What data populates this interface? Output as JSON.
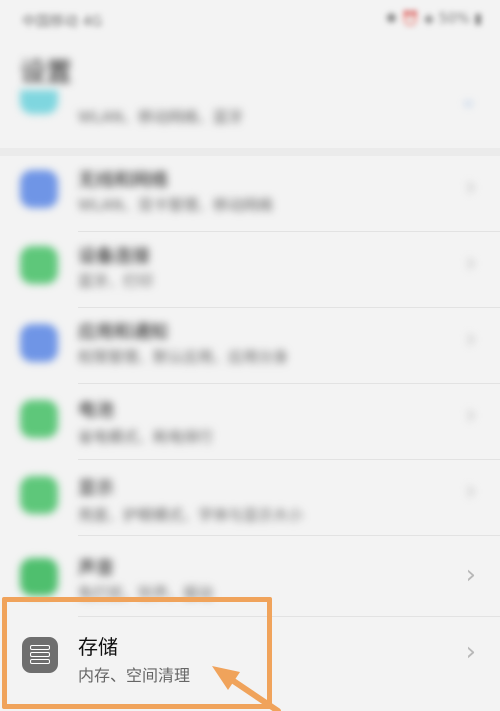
{
  "status_bar": {
    "left_text": "中国移动 4G",
    "right_text": "✱ ⏰ ◈ 50% ▮"
  },
  "page": {
    "title": "设置"
  },
  "rows": [
    {
      "title": "",
      "subtitle": "WLAN、移动网络、蓝牙",
      "icon_color": "#7fd6df"
    },
    {
      "title": "无线和网络",
      "subtitle": "WLAN、双卡管理、移动网络",
      "icon_color": "#6f95e6"
    },
    {
      "title": "设备连接",
      "subtitle": "蓝牙、打印",
      "icon_color": "#5ec77a"
    },
    {
      "title": "应用和通知",
      "subtitle": "权限管理、默认应用、应用分身",
      "icon_color": "#6f95e6"
    },
    {
      "title": "电池",
      "subtitle": "省电模式、耗电排行",
      "icon_color": "#5ec77a"
    },
    {
      "title": "显示",
      "subtitle": "亮度、护眼模式、字体与显示大小",
      "icon_color": "#5ec77a"
    },
    {
      "title": "声音",
      "subtitle": "免打扰、铃声、振动",
      "icon_color": "#4fbf6e"
    }
  ],
  "storage": {
    "title": "存储",
    "subtitle": "内存、空间清理",
    "icon": "storage-icon"
  },
  "colors": {
    "highlight": "#f0a35b"
  }
}
